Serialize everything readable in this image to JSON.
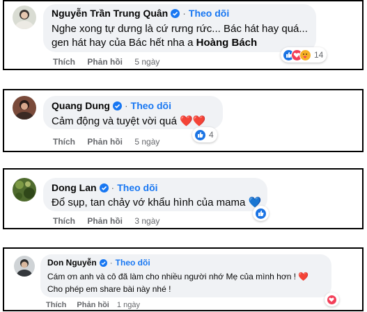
{
  "comments": [
    {
      "name": "Nguyễn Trần Trung Quân",
      "follow": "Theo dõi",
      "line1": "Nghe xong tự dưng là cứ rưng rức... Bác hát hay quá...",
      "line2_prefix": "gen hát hay của Bác hết nha a ",
      "mention": "Hoàng Bách",
      "like": "Thích",
      "reply": "Phản hồi",
      "time": "5 ngày",
      "reaction_icons": [
        "like-icon",
        "love-icon",
        "care-icon"
      ],
      "reaction_count": "14"
    },
    {
      "name": "Quang Dung",
      "follow": "Theo dõi",
      "line1": "Cảm động và tuyệt vời quá ❤️❤️",
      "like": "Thích",
      "reply": "Phản hồi",
      "time": "5 ngày",
      "reaction_icons": [
        "like-icon"
      ],
      "reaction_count": "4"
    },
    {
      "name": "Dong Lan",
      "follow": "Theo dõi",
      "line1": "Đổ sụp, tan chảy vớ khẩu hình của mama 💙",
      "like": "Thích",
      "reply": "Phản hồi",
      "time": "3 ngày",
      "reaction_icons": [
        "like-icon"
      ]
    },
    {
      "name": "Don Nguyễn",
      "follow": "Theo dõi",
      "line1": "Cám ơn anh và cô đã làm cho nhiều người nhớ Mẹ của mình hơn ! ❤️",
      "line2": "Cho phép em share bài này nhé !",
      "like": "Thích",
      "reply": "Phản hồi",
      "time": "1 ngày",
      "reaction_icons": [
        "love-icon"
      ]
    }
  ],
  "colors": {
    "bubble": "#f0f2f5",
    "follow": "#1877f2",
    "meta": "#65676b",
    "like": "#1b74e4",
    "love": "#f33e58",
    "care": "#f7b125"
  }
}
